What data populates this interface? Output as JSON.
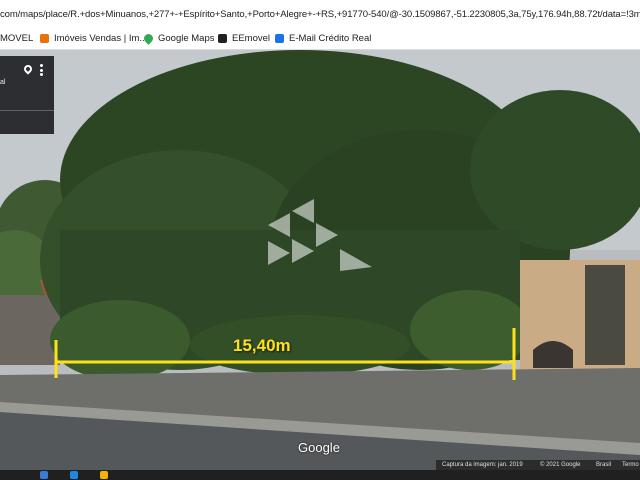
{
  "browser": {
    "url": "com/maps/place/R.+dos+Minuanos,+277+-+Espírito+Santo,+Porto+Alegre+-+RS,+91770-540/@-30.1509867,-51.2230805,3a,75y,176.94h,88.72t/data=!3m6",
    "bookmarks": [
      {
        "label": "MOVEL",
        "icon": "bookmark-icon",
        "color": "#c8c8c8"
      },
      {
        "label": "Imóveis Vendas | Im...",
        "icon": "house-favicon",
        "color": "#e8710a"
      },
      {
        "label": "Google Maps",
        "icon": "maps-pin-favicon",
        "color": "#34a853"
      },
      {
        "label": "EEmovel",
        "icon": "eemovel-favicon",
        "color": "#202124"
      },
      {
        "label": "E-Mail Crédito Real",
        "icon": "mail-favicon",
        "color": "#1a73e8"
      }
    ]
  },
  "info_card": {
    "fragment": "al"
  },
  "measurement": {
    "label": "15,40m",
    "color": "#ffe11a"
  },
  "map": {
    "logo": "Google",
    "footer": {
      "capture": "Captura da imagem: jan. 2019",
      "copyright": "© 2021 Google",
      "country": "Brasil",
      "terms": "Termo"
    }
  }
}
